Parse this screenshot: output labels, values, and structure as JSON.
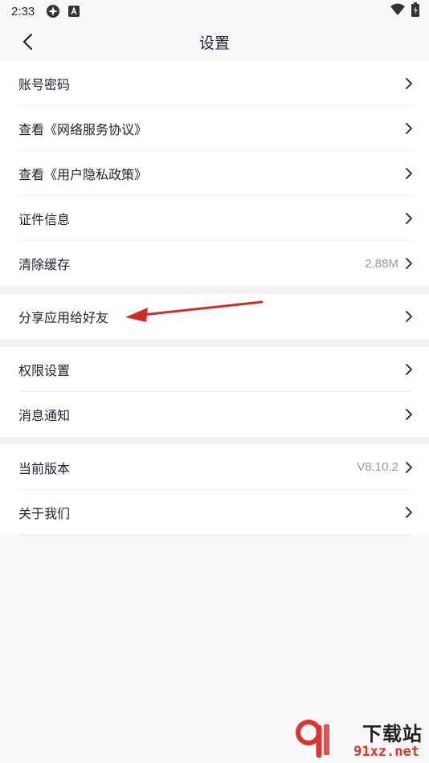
{
  "status_bar": {
    "time": "2:33"
  },
  "header": {
    "title": "设置"
  },
  "groups": [
    {
      "items": [
        {
          "label": "账号密码"
        },
        {
          "label": "查看《网络服务协议》"
        },
        {
          "label": "查看《用户隐私政策》"
        },
        {
          "label": "证件信息"
        },
        {
          "label": "清除缓存",
          "value": "2.88M"
        }
      ]
    },
    {
      "items": [
        {
          "label": "分享应用给好友"
        }
      ]
    },
    {
      "items": [
        {
          "label": "权限设置"
        },
        {
          "label": "消息通知"
        }
      ]
    },
    {
      "items": [
        {
          "label": "当前版本",
          "value": "V8.10.2"
        },
        {
          "label": "关于我们"
        }
      ]
    }
  ],
  "annotation": {
    "color": "#d42a26"
  },
  "watermark": {
    "top": "下载站",
    "bottom": "91xz.net",
    "brand_color": "#e0332b"
  }
}
